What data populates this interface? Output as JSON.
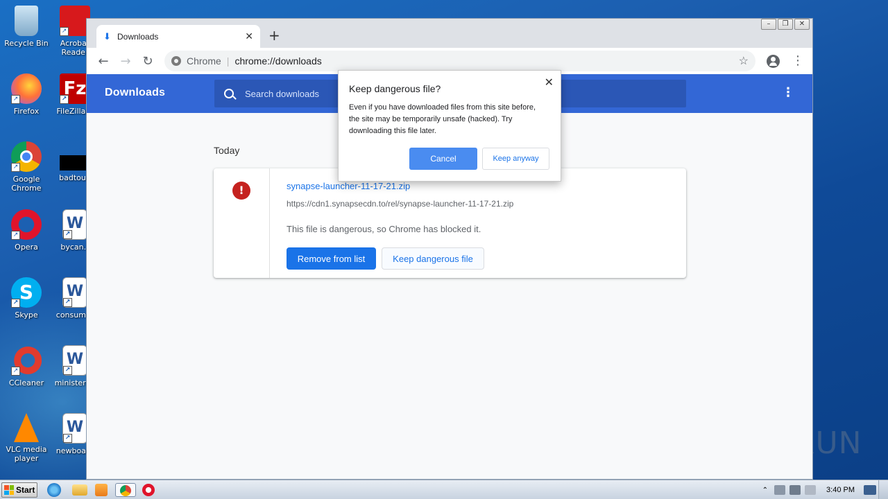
{
  "desktop": {
    "icons": [
      {
        "label": "Recycle Bin"
      },
      {
        "label": "Acrobat Reader"
      },
      {
        "label": "Firefox"
      },
      {
        "label": "FileZilla C"
      },
      {
        "label": "Google Chrome"
      },
      {
        "label": "badtour."
      },
      {
        "label": "Opera"
      },
      {
        "label": "bycan.r"
      },
      {
        "label": "Skype"
      },
      {
        "label": "consumer"
      },
      {
        "label": "CCleaner"
      },
      {
        "label": "ministerap"
      },
      {
        "label": "VLC media player"
      },
      {
        "label": "newboard"
      }
    ],
    "watermark": "ANY RUN"
  },
  "browser": {
    "tab": {
      "title": "Downloads",
      "icon": "download-icon"
    },
    "window_controls": [
      "minimize",
      "restore",
      "close"
    ],
    "omnibox": {
      "chip": "Chrome",
      "url": "chrome://downloads"
    }
  },
  "downloads_page": {
    "title": "Downloads",
    "search": {
      "placeholder": "Search downloads"
    },
    "section_label": "Today",
    "item": {
      "file_name": "synapse-launcher-11-17-21.zip",
      "url": "https://cdn1.synapsecdn.to/rel/synapse-launcher-11-17-21.zip",
      "status": "This file is dangerous, so Chrome has blocked it.",
      "remove_label": "Remove from list",
      "keep_label": "Keep dangerous file",
      "danger_glyph": "!"
    }
  },
  "dialog": {
    "title": "Keep dangerous file?",
    "body_lines": [
      "Even if you have downloaded files from this site before,",
      "the site may be temporarily unsafe (hacked). Try",
      "downloading this file later."
    ],
    "cancel_label": "Cancel",
    "keep_label": "Keep anyway"
  },
  "taskbar": {
    "start_label": "Start",
    "clock": "3:40 PM"
  },
  "colors": {
    "header_blue": "#3367d6",
    "link_blue": "#1a73e8",
    "danger_red": "#c5221f"
  }
}
